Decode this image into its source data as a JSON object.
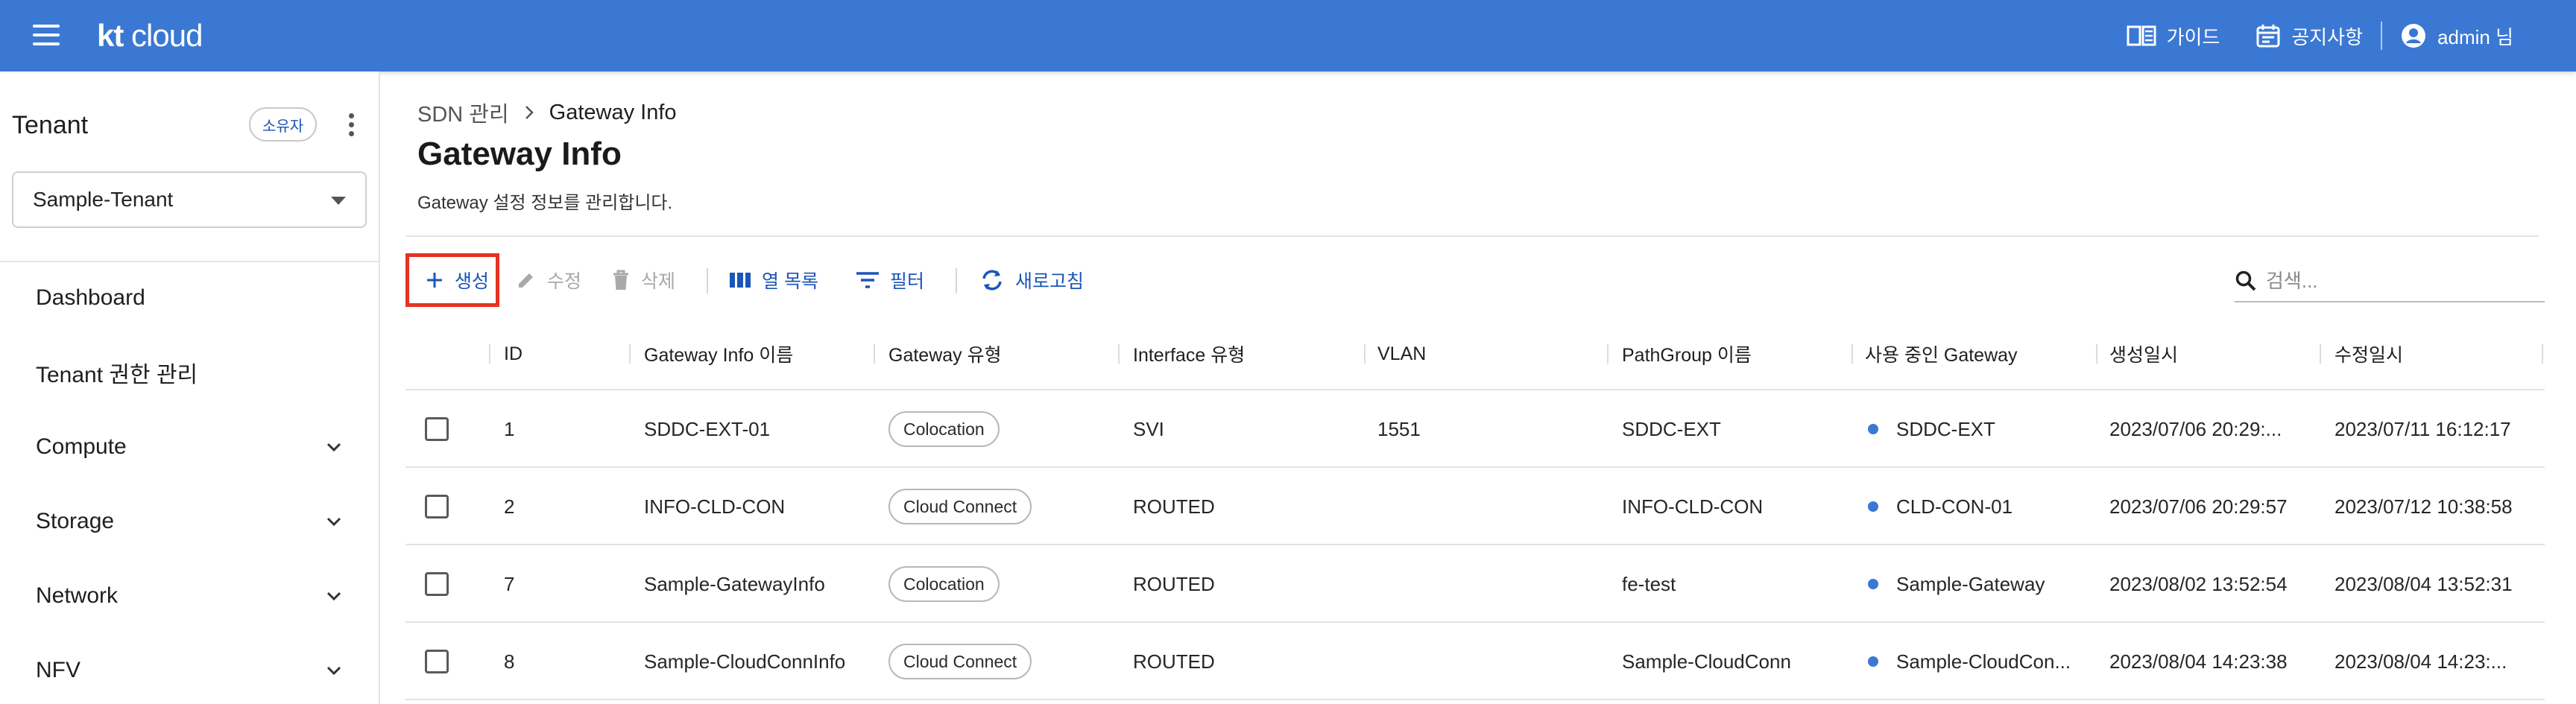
{
  "header": {
    "logo_bold": "kt",
    "logo_light": " cloud",
    "guide_label": "가이드",
    "notice_label": "공지사항",
    "user_label": "admin 님",
    "bar_color": "#3a78d3"
  },
  "sidebar": {
    "tenant_title": "Tenant",
    "owner_badge": "소유자",
    "tenant_selected": "Sample-Tenant",
    "items": [
      {
        "label": "Dashboard",
        "expandable": false
      },
      {
        "label": "Tenant 권한 관리",
        "expandable": false
      },
      {
        "label": "Compute",
        "expandable": true
      },
      {
        "label": "Storage",
        "expandable": true
      },
      {
        "label": "Network",
        "expandable": true
      },
      {
        "label": "NFV",
        "expandable": true
      }
    ]
  },
  "breadcrumb": {
    "parent": "SDN 관리",
    "current": "Gateway Info"
  },
  "page": {
    "title": "Gateway Info",
    "description": "Gateway 설정 정보를 관리합니다."
  },
  "toolbar": {
    "create": "생성",
    "edit": "수정",
    "delete": "삭제",
    "columns": "열 목록",
    "filter": "필터",
    "refresh": "새로고침",
    "search_placeholder": "검색..."
  },
  "table": {
    "columns": [
      "ID",
      "Gateway Info 이름",
      "Gateway 유형",
      "Interface 유형",
      "VLAN",
      "PathGroup 이름",
      "사용 중인 Gateway",
      "생성일시",
      "수정일시"
    ],
    "rows": [
      {
        "id": "1",
        "name": "SDDC-EXT-01",
        "gw_type": "Colocation",
        "if_type": "SVI",
        "vlan": "1551",
        "pathgroup": "SDDC-EXT",
        "gateway": "SDDC-EXT",
        "created": "2023/07/06 20:29:...",
        "modified": "2023/07/11 16:12:17"
      },
      {
        "id": "2",
        "name": "INFO-CLD-CON",
        "gw_type": "Cloud Connect",
        "if_type": "ROUTED",
        "vlan": "",
        "pathgroup": "INFO-CLD-CON",
        "gateway": "CLD-CON-01",
        "created": "2023/07/06 20:29:57",
        "modified": "2023/07/12 10:38:58"
      },
      {
        "id": "7",
        "name": "Sample-GatewayInfo",
        "gw_type": "Colocation",
        "if_type": "ROUTED",
        "vlan": "",
        "pathgroup": "fe-test",
        "gateway": "Sample-Gateway",
        "created": "2023/08/02 13:52:54",
        "modified": "2023/08/04 13:52:31"
      },
      {
        "id": "8",
        "name": "Sample-CloudConnInfo",
        "gw_type": "Cloud Connect",
        "if_type": "ROUTED",
        "vlan": "",
        "pathgroup": "Sample-CloudConn",
        "gateway": "Sample-CloudCon...",
        "created": "2023/08/04 14:23:38",
        "modified": "2023/08/04 14:23:..."
      }
    ]
  }
}
